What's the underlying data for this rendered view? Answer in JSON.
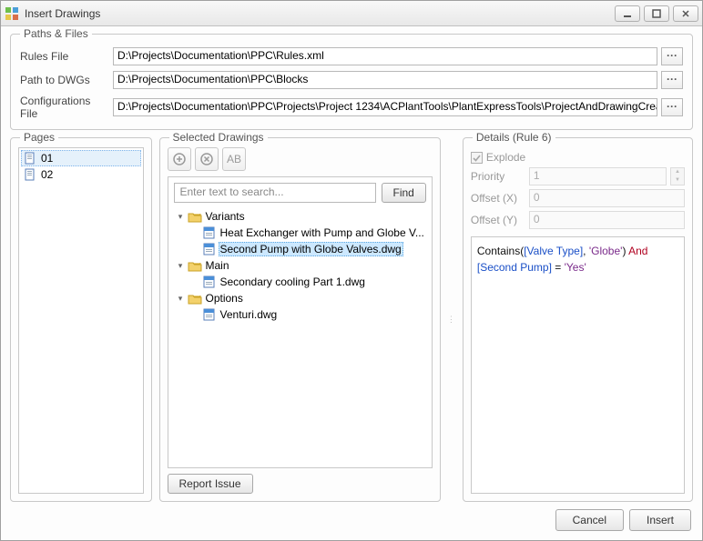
{
  "window": {
    "title": "Insert Drawings"
  },
  "paths_group": {
    "title": "Paths & Files",
    "rules_label": "Rules File",
    "rules_value": "D:\\Projects\\Documentation\\PPC\\Rules.xml",
    "dwg_label": "Path to DWGs",
    "dwg_value": "D:\\Projects\\Documentation\\PPC\\Blocks",
    "config_label": "Configurations File",
    "config_value": "D:\\Projects\\Documentation\\PPC\\Projects\\Project 1234\\ACPlantTools\\PlantExpressTools\\ProjectAndDrawingCreate\\ProjectCc"
  },
  "pages": {
    "title": "Pages",
    "items": [
      "01",
      "02"
    ],
    "selected_index": 0
  },
  "selected": {
    "title": "Selected Drawings",
    "search_placeholder": "Enter text to search...",
    "find_label": "Find",
    "report_label": "Report Issue",
    "tree": [
      {
        "type": "folder",
        "label": "Variants",
        "expanded": true,
        "depth": 1
      },
      {
        "type": "file",
        "label": "Heat Exchanger with Pump and Globe V...",
        "depth": 2
      },
      {
        "type": "file",
        "label": "Second Pump with Globe Valves.dwg",
        "depth": 2,
        "selected": true
      },
      {
        "type": "folder",
        "label": "Main",
        "expanded": true,
        "depth": 1
      },
      {
        "type": "file",
        "label": "Secondary cooling Part 1.dwg",
        "depth": 2
      },
      {
        "type": "folder",
        "label": "Options",
        "expanded": true,
        "depth": 1
      },
      {
        "type": "file",
        "label": "Venturi.dwg",
        "depth": 2
      }
    ]
  },
  "details": {
    "title": "Details (Rule 6)",
    "explode_label": "Explode",
    "explode_checked": true,
    "priority_label": "Priority",
    "priority_value": "1",
    "offsetx_label": "Offset (X)",
    "offsetx_value": "0",
    "offsety_label": "Offset (Y)",
    "offsety_value": "0",
    "rule": {
      "fn": "Contains(",
      "field1": "[Valve Type]",
      "comma": ", ",
      "str1": "'Globe'",
      "close": ") ",
      "op": "And",
      "field2": "[Second Pump]",
      "eq": " = ",
      "str2": "'Yes'"
    }
  },
  "footer": {
    "cancel_label": "Cancel",
    "insert_label": "Insert"
  }
}
